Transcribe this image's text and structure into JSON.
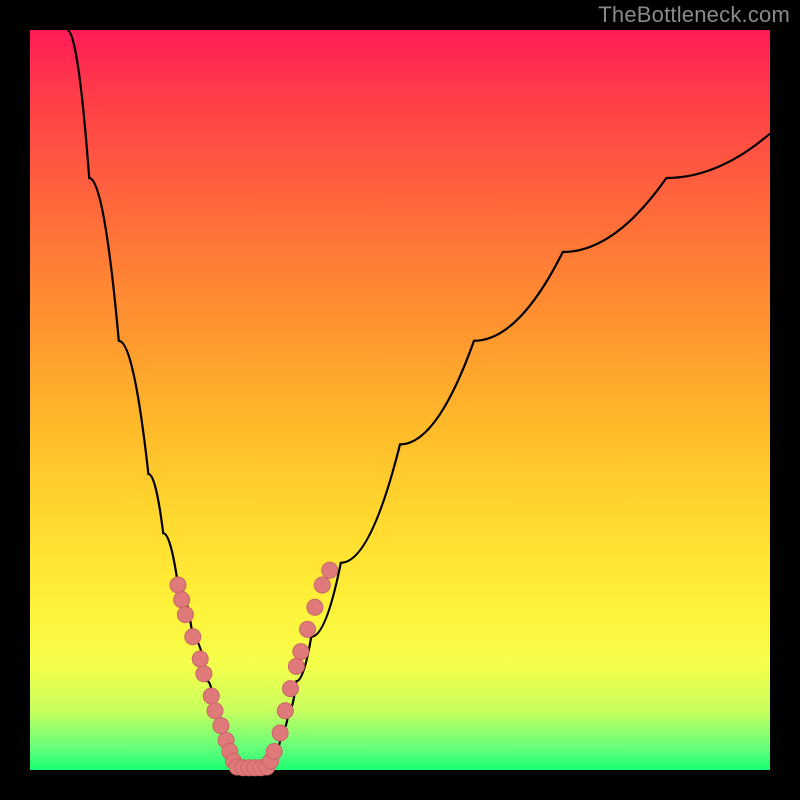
{
  "watermark": {
    "text": "TheBottleneck.com"
  },
  "colors": {
    "frame": "#000000",
    "curve": "#000000",
    "dot_fill": "#e07a7a",
    "dot_stroke": "#c86666",
    "gradient_top": "#ff1a57",
    "gradient_bottom": "#1bff72"
  },
  "chart_data": {
    "type": "line",
    "title": "",
    "xlabel": "",
    "ylabel": "",
    "xlim": [
      0,
      100
    ],
    "ylim": [
      0,
      100
    ],
    "grid": false,
    "legend": false,
    "annotations": [
      "TheBottleneck.com"
    ],
    "series": [
      {
        "name": "left-curve",
        "x": [
          5,
          8,
          12,
          16,
          18,
          20,
          22,
          24,
          25,
          26,
          27,
          28
        ],
        "y": [
          100,
          80,
          58,
          40,
          32,
          25,
          18,
          12,
          8,
          5,
          2,
          0
        ]
      },
      {
        "name": "right-curve",
        "x": [
          32,
          33,
          34,
          35,
          36,
          38,
          42,
          50,
          60,
          72,
          86,
          100
        ],
        "y": [
          0,
          2,
          5,
          8,
          12,
          18,
          28,
          44,
          58,
          70,
          80,
          86
        ]
      }
    ],
    "scatter": [
      {
        "name": "dots-left",
        "points": [
          {
            "x": 20.0,
            "y": 25
          },
          {
            "x": 20.5,
            "y": 23
          },
          {
            "x": 21.0,
            "y": 21
          },
          {
            "x": 22.0,
            "y": 18
          },
          {
            "x": 23.0,
            "y": 15
          },
          {
            "x": 23.5,
            "y": 13
          },
          {
            "x": 24.5,
            "y": 10
          },
          {
            "x": 25.0,
            "y": 8
          },
          {
            "x": 25.8,
            "y": 6
          },
          {
            "x": 26.5,
            "y": 4
          },
          {
            "x": 27.0,
            "y": 2.5
          },
          {
            "x": 27.5,
            "y": 1.2
          }
        ]
      },
      {
        "name": "dots-bottom",
        "points": [
          {
            "x": 28.0,
            "y": 0.4
          },
          {
            "x": 28.8,
            "y": 0.3
          },
          {
            "x": 29.6,
            "y": 0.3
          },
          {
            "x": 30.4,
            "y": 0.3
          },
          {
            "x": 31.2,
            "y": 0.3
          },
          {
            "x": 32.0,
            "y": 0.4
          }
        ]
      },
      {
        "name": "dots-right",
        "points": [
          {
            "x": 32.5,
            "y": 1.2
          },
          {
            "x": 33.0,
            "y": 2.5
          },
          {
            "x": 33.8,
            "y": 5
          },
          {
            "x": 34.5,
            "y": 8
          },
          {
            "x": 35.2,
            "y": 11
          },
          {
            "x": 36.0,
            "y": 14
          },
          {
            "x": 36.6,
            "y": 16
          },
          {
            "x": 37.5,
            "y": 19
          },
          {
            "x": 38.5,
            "y": 22
          },
          {
            "x": 39.5,
            "y": 25
          },
          {
            "x": 40.5,
            "y": 27
          }
        ]
      }
    ]
  }
}
